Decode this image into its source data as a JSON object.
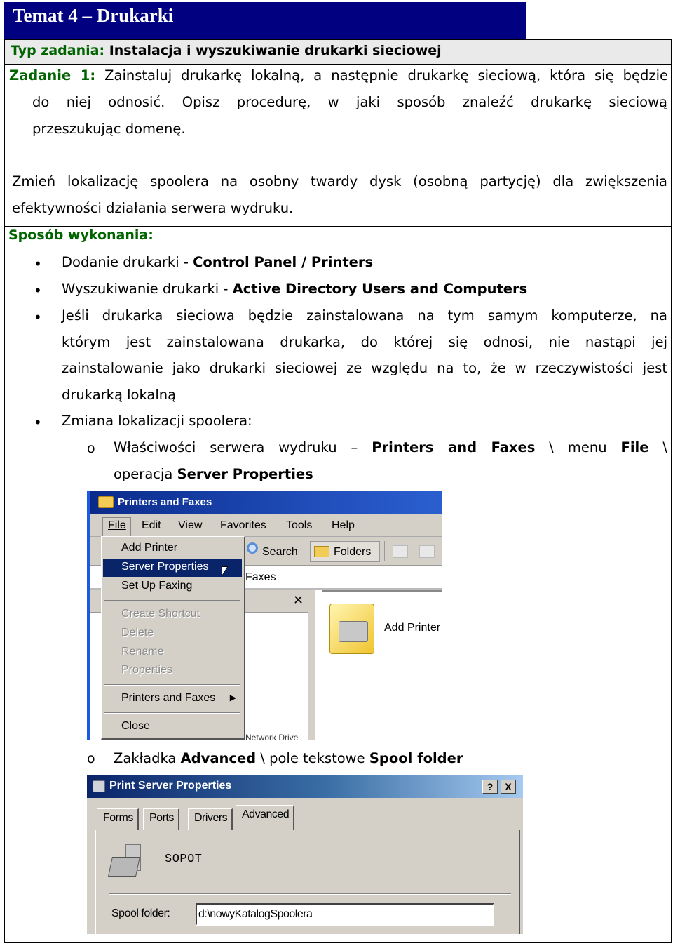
{
  "header": {
    "title": "Temat 4 – Drukarki"
  },
  "task_type": {
    "label": "Typ zadania:",
    "value": "Instalacja i wyszukiwanie drukarki sieciowej"
  },
  "task1": {
    "label": "Zadanie 1:",
    "line1": "Zainstaluj drukarkę lokalną, a następnie drukarkę sieciową, która się będzie",
    "line2": "do niej odnosić. Opisz procedurę, w jaki sposób znaleźć drukarkę sieciową",
    "line3": "przeszukując domenę.",
    "para2_line1": "Zmień lokalizację spoolera na osobny twardy dysk (osobną partycję) dla zwiększenia",
    "para2_line2": "efektywności działania serwera wydruku."
  },
  "method": {
    "heading": "Sposób wykonania:",
    "bullets": [
      {
        "text": "Dodanie drukarki - ",
        "bold": "Control Panel / Printers"
      },
      {
        "text": "Wyszukiwanie drukarki - ",
        "bold": "Active Directory Users and Computers"
      },
      {
        "lines": [
          "Jeśli drukarka sieciowa będzie zainstalowana na tym samym komputerze, na",
          "którym jest zainstalowana drukarka, do której się odnosi, nie nastąpi jej",
          "zainstalowanie jako drukarki sieciowej ze względu na to, że w rzeczywistości jest",
          "drukarką lokalną"
        ]
      },
      {
        "text": "Zmiana lokalizacji spoolera:"
      }
    ],
    "sub1": {
      "t1": "Właściwości serwera wydruku – ",
      "b1": "Printers and Faxes",
      "t2": " \\ menu ",
      "b2": "File",
      "t3": " \\",
      "t4": "operacja ",
      "b3": "Server Properties"
    },
    "sub2": {
      "t1": "Zakładka ",
      "b1": "Advanced",
      "t2": " \\ pole tekstowe ",
      "b2": "Spool folder"
    }
  },
  "bullet_glyph": "•",
  "circle_glyph": "o",
  "screenshot1": {
    "window_title": "Printers and Faxes",
    "menu": [
      "File",
      "Edit",
      "View",
      "Favorites",
      "Tools",
      "Help"
    ],
    "toolbar": {
      "search": "Search",
      "folders": "Folders"
    },
    "address_text": "Faxes",
    "close_glyph": "✕",
    "file_menu": {
      "items": [
        {
          "label": "Add Printer",
          "state": "normal"
        },
        {
          "label": "Server Properties",
          "state": "selected"
        },
        {
          "label": "Set Up Faxing",
          "state": "normal"
        },
        {
          "label": "Create Shortcut",
          "state": "disabled"
        },
        {
          "label": "Delete",
          "state": "disabled"
        },
        {
          "label": "Rename",
          "state": "disabled"
        },
        {
          "label": "Properties",
          "state": "disabled"
        },
        {
          "label": "Printers and Faxes",
          "state": "submenu"
        },
        {
          "label": "Close",
          "state": "normal"
        }
      ],
      "submenu_arrow": "▶"
    },
    "add_printer_label": "Add Printer",
    "partial_text": "Network Drive"
  },
  "screenshot2": {
    "window_title": "Print Server Properties",
    "help_button": "?",
    "close_button": "X",
    "tabs": [
      "Forms",
      "Ports",
      "Drivers",
      "Advanced"
    ],
    "active_tab": "Advanced",
    "server_name": "SOPOT",
    "spool_label": "Spool folder:",
    "spool_value": "d:\\nowyKatalogSpoolera"
  }
}
